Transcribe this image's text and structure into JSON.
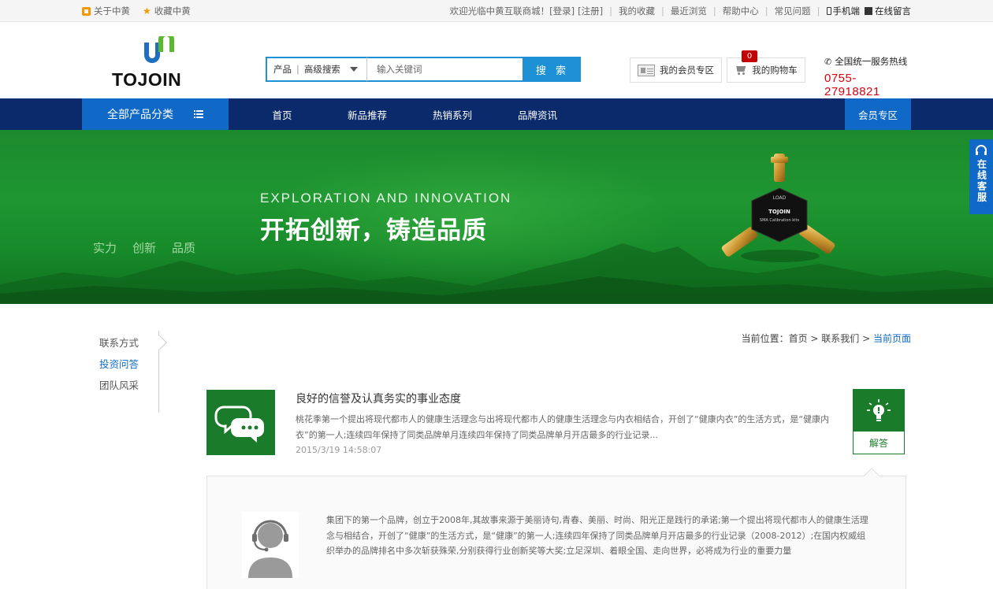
{
  "topbar": {
    "about": "关于中黄",
    "favorite": "收藏中黄",
    "welcome": "欢迎光临中黄互联商城！",
    "login": "[登录]",
    "register": "[注册]",
    "my_favorites": "我的收藏",
    "recent": "最近浏览",
    "help": "帮助中心",
    "faq": "常见问题",
    "mobile": "手机端",
    "message": "在线留言"
  },
  "header": {
    "logo_text": "TOJOIN",
    "search": {
      "category": "产品",
      "advanced": "高级搜索",
      "placeholder": "输入关键词",
      "button": "搜 索"
    },
    "member_zone": "我的会员专区",
    "cart": "我的购物车",
    "cart_count": "0",
    "hotline_label": "全国统一服务热线",
    "hotline_number": "0755-27918821"
  },
  "nav": {
    "all_categories": "全部产品分类",
    "links": [
      "首页",
      "新品推荐",
      "热销系列",
      "品牌资讯"
    ],
    "vip": "会员专区"
  },
  "banner": {
    "english": "EXPLORATION AND INNOVATION",
    "chinese": "开拓创新，铸造品质",
    "tags": [
      "实力",
      "创新",
      "品质"
    ],
    "product_label_top": "LOAD",
    "product_brand": "TOJOIN",
    "product_caption": "SMA Calibration kits"
  },
  "online_service": "在线客服",
  "sidebar": {
    "items": [
      "联系方式",
      "投资问答",
      "团队风采"
    ],
    "active_index": 1
  },
  "breadcrumb": {
    "prefix": "当前位置：",
    "home": "首页",
    "section": "联系我们",
    "current": "当前页面",
    "sep": " > "
  },
  "qa": {
    "title": "良好的信誉及认真务实的事业态度",
    "description": "桃花季第一个提出将现代都市人的健康生活理念与出将现代都市人的健康生活理念与内衣相结合，开创了“健康内衣”的生活方式，是“健康内衣”的第一人;连续四年保持了同类品牌单月连续四年保持了同类品牌单月开店最多的行业记录...",
    "time": "2015/3/19 14:58:07",
    "answer_label": "解答"
  },
  "answer": {
    "text": "集团下的第一个品牌，创立于2008年,其故事来源于美丽诗句,青春、美丽、时尚、阳光正是践行的承诺;第一个提出将现代都市人的健康生活理念与相结合，开创了“健康”的生活方式，是“健康”的第一人;连续四年保持了同类品牌单月开店最多的行业记录（2008-2012）;在国内权威组织举办的品牌排名中多次斩获殊荣,分别获得行业创新奖等大奖;立足深圳、着眼全国、走向世界，必将成为行业的重要力量"
  },
  "colors": {
    "nav_bg": "#0b2a6b",
    "accent_blue": "#1069c7",
    "search_blue": "#1e90d6",
    "green": "#1a7b2b",
    "hotline_red": "#d7000f"
  }
}
